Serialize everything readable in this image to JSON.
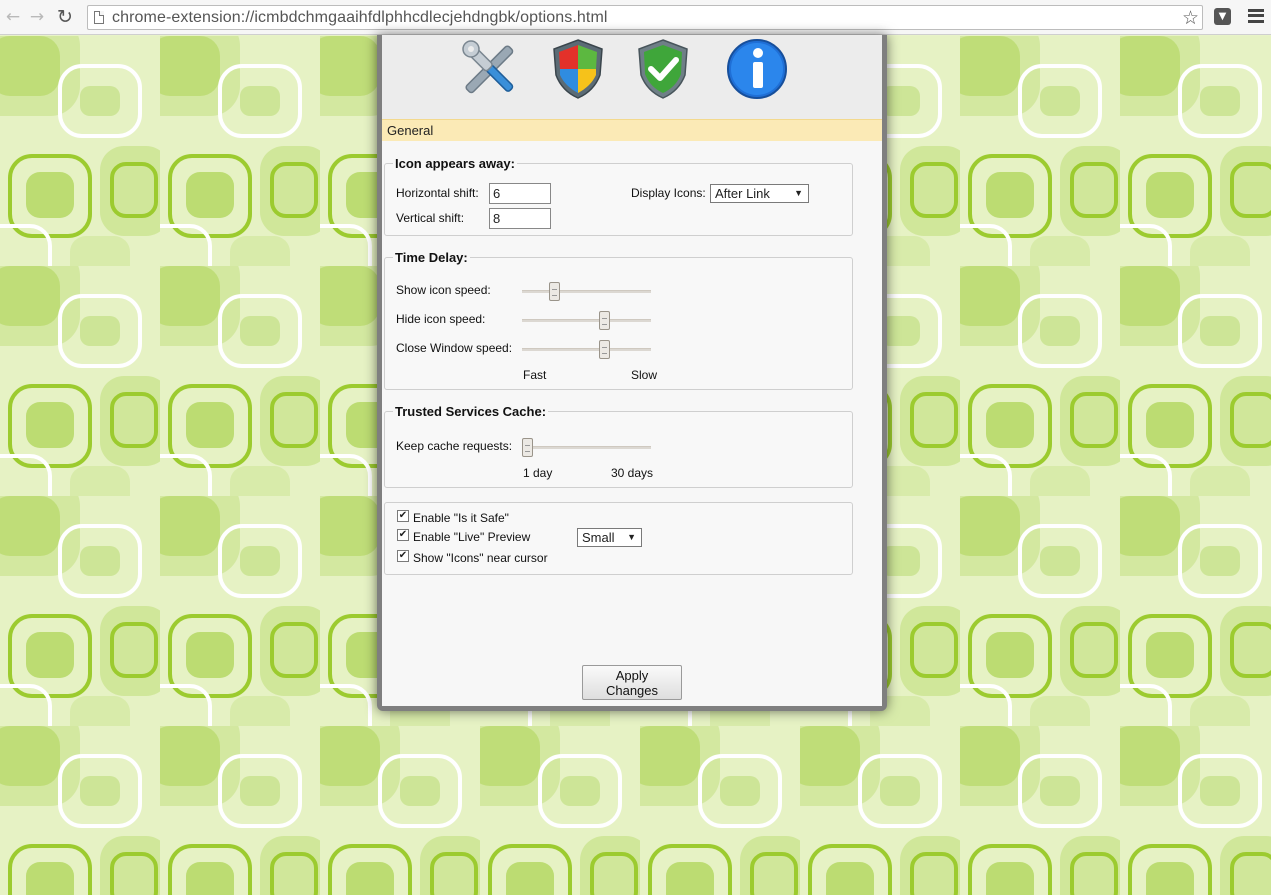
{
  "browser": {
    "url": "chrome-extension://icmbdchmgaaihfdlphhcdlecjehdngbk/options.html"
  },
  "colors": {
    "wallpaper_light": "#e8f3c8",
    "wallpaper_mid": "#c6e08a",
    "wallpaper_accent": "#9cca2e",
    "header_bar": "#fbeab6"
  },
  "tabs": [
    {
      "icon": "tools-icon"
    },
    {
      "icon": "windows-shield-icon"
    },
    {
      "icon": "green-check-shield-icon"
    },
    {
      "icon": "info-icon"
    }
  ],
  "section_title": "General",
  "icon_group": {
    "legend": "Icon appears away:",
    "horizontal_label": "Horizontal shift:",
    "horizontal_value": "6",
    "vertical_label": "Vertical shift:",
    "vertical_value": "8",
    "display_label": "Display Icons:",
    "display_value": "After Link"
  },
  "time_group": {
    "legend": "Time Delay:",
    "show_label": "Show icon speed:",
    "show_level": 0.23,
    "hide_label": "Hide icon speed:",
    "hide_level": 0.65,
    "close_label": "Close Window speed:",
    "close_level": 0.65,
    "min_label": "Fast",
    "max_label": "Slow"
  },
  "cache_group": {
    "legend": "Trusted Services Cache:",
    "keep_label": "Keep cache requests:",
    "keep_level": 0.0,
    "min_label": "1 day",
    "max_label": "30 days"
  },
  "options_group": {
    "safe_label": "Enable \"Is it Safe\"",
    "safe_checked": true,
    "live_label": "Enable \"Live\" Preview",
    "live_checked": true,
    "preview_size": "Small",
    "icons_label": "Show \"Icons\" near cursor",
    "icons_checked": true
  },
  "apply_label": "Apply Changes"
}
